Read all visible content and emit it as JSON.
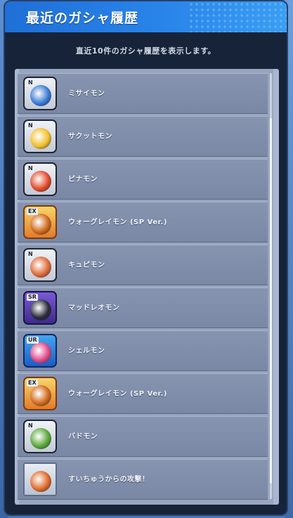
{
  "dialog": {
    "title": "最近のガシャ履歴",
    "subtitle": "直近10件のガシャ履歴を表示します。"
  },
  "history": [
    {
      "name": "ミサイモン",
      "icon": "character-card-icon",
      "rarity": "plain",
      "level": "N",
      "accent": "#3a7bd5"
    },
    {
      "name": "サクットモン",
      "icon": "character-card-icon",
      "rarity": "plain",
      "level": "N",
      "accent": "#f2c02a"
    },
    {
      "name": "ピナモン",
      "icon": "character-card-icon",
      "rarity": "plain",
      "level": "N",
      "accent": "#e24a2a"
    },
    {
      "name": "ウォーグレイモン (SP Ver.)",
      "icon": "character-card-icon",
      "rarity": "gold",
      "level": "EX",
      "accent": "#d06a1a"
    },
    {
      "name": "キュピモン",
      "icon": "character-card-icon",
      "rarity": "plain",
      "level": "N",
      "accent": "#e06a3a"
    },
    {
      "name": "マッドレオモン",
      "icon": "character-card-icon",
      "rarity": "purple",
      "level": "SR",
      "accent": "#2a2a3a"
    },
    {
      "name": "シェルモン",
      "icon": "character-card-icon",
      "rarity": "blue",
      "level": "UR",
      "accent": "#e04a8a"
    },
    {
      "name": "ウォーグレイモン (SP Ver.)",
      "icon": "character-card-icon",
      "rarity": "gold",
      "level": "EX",
      "accent": "#d06a1a"
    },
    {
      "name": "バドモン",
      "icon": "character-card-icon",
      "rarity": "plain",
      "level": "N",
      "accent": "#5aa83a"
    },
    {
      "name": "すいちゅうからの攻撃！",
      "icon": "item-card-icon",
      "rarity": "ticket",
      "level": "",
      "accent": "#e06a2a"
    }
  ]
}
